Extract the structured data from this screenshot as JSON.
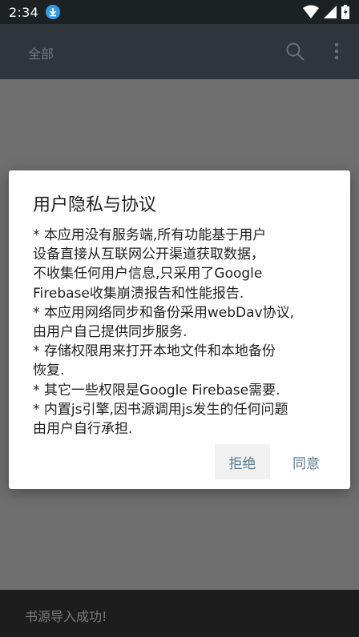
{
  "status_bar": {
    "time": "2:34"
  },
  "toolbar": {
    "title": "全部"
  },
  "dialog": {
    "title": "用户隐私与协议",
    "body_lines": [
      "* 本应用没有服务端,所有功能基于用户",
      "设备直接从互联网公开渠道获取数据，",
      "不收集任何用户信息,只采用了Google",
      "Firebase收集崩溃报告和性能报告.",
      "* 本应用网络同步和备份采用webDav协议,",
      "由用户自己提供同步服务.",
      "* 存储权限用来打开本地文件和本地备份",
      "恢复.",
      "* 其它一些权限是Google Firebase需要.",
      "* 内置js引擎,因书源调用js发生的任何问题",
      "由用户自行承担."
    ],
    "reject_label": "拒绝",
    "agree_label": "同意"
  },
  "snackbar": {
    "message": "书源导入成功!"
  },
  "colors": {
    "status_bar_bg": "#1c2124",
    "toolbar_bg": "#2e363b",
    "scrim": "#6f6f6f",
    "button_text": "#5a7e94",
    "snackbar_bg": "#1d1d1d"
  },
  "icons": [
    "download-icon",
    "wifi-icon",
    "signal-icon",
    "battery-icon",
    "search-icon",
    "more-vert-icon"
  ]
}
